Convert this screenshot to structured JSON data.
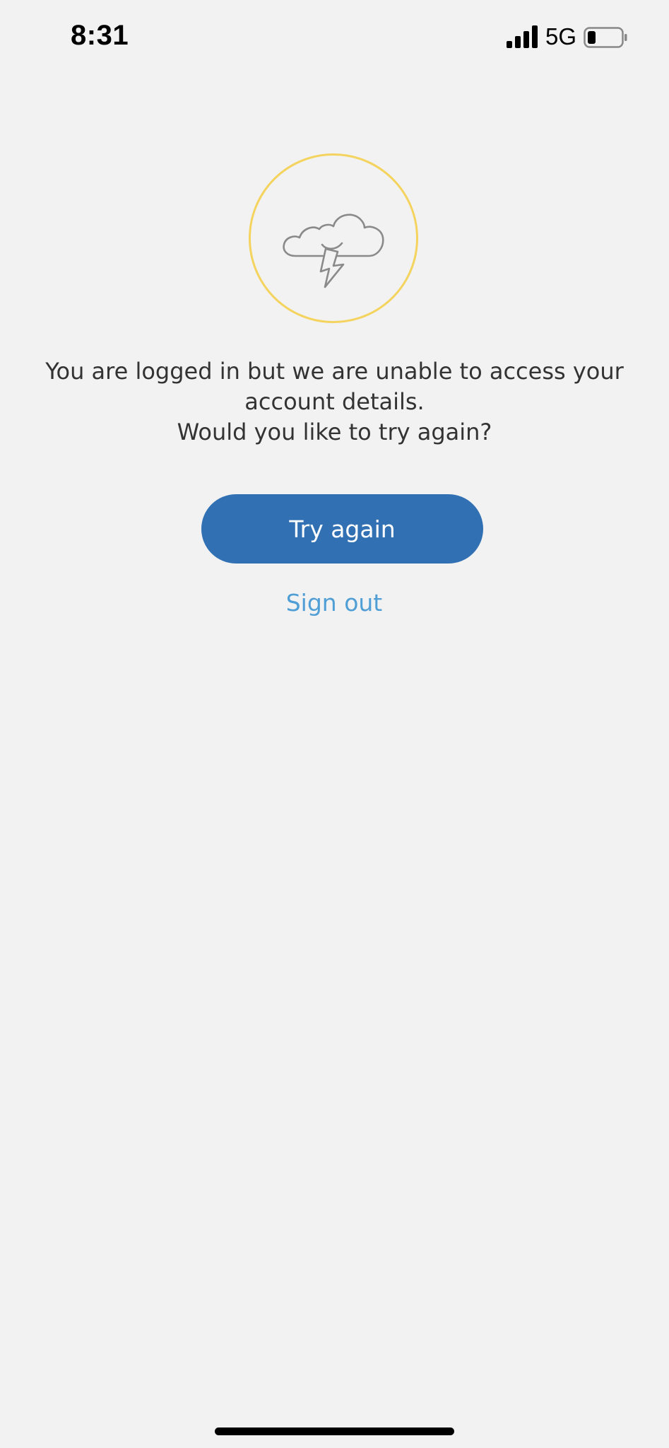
{
  "status_bar": {
    "time": "8:31",
    "network": "5G",
    "signal_icon": "signal-bars-icon",
    "battery_icon": "battery-low-icon",
    "battery_level": 0.2
  },
  "error": {
    "icon": "storm-cloud-icon",
    "accent_color": "#f4d35e",
    "message_line1": "You are logged in but we are unable to access your",
    "message_line2": "account details.",
    "message_line3": "Would you like to try again?"
  },
  "actions": {
    "try_again_label": "Try again",
    "sign_out_label": "Sign out",
    "primary_color": "#3070b3",
    "link_color": "#4f9fd6"
  }
}
